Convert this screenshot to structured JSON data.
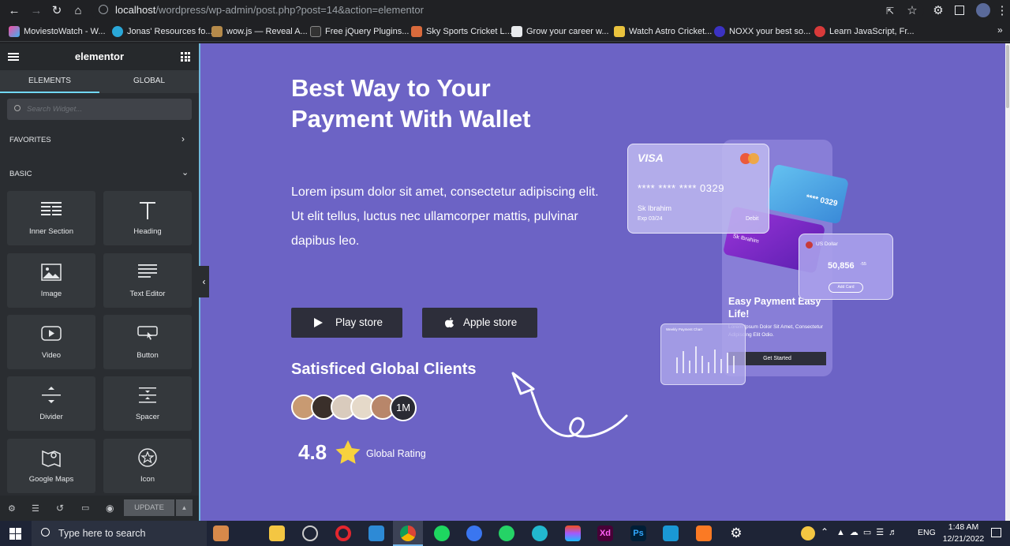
{
  "browser": {
    "url_host": "localhost",
    "url_path": "/wordpress/wp-admin/post.php?post=14&action=elementor",
    "bookmarks": [
      "MoviestoWatch - W...",
      "Jonas' Resources fo...",
      "wow.js — Reveal A...",
      "Free jQuery Plugins...",
      "Sky Sports Cricket L...",
      "Grow your career w...",
      "Watch Astro Cricket...",
      "NOXX your best so...",
      "Learn JavaScript, Fr..."
    ]
  },
  "editor": {
    "logo": "elementor",
    "tabs": [
      "ELEMENTS",
      "GLOBAL"
    ],
    "search_placeholder": "Search Widget...",
    "favorites_label": "FAVORITES",
    "basic_label": "BASIC",
    "widgets": [
      "Inner Section",
      "Heading",
      "Image",
      "Text Editor",
      "Video",
      "Button",
      "Divider",
      "Spacer",
      "Google Maps",
      "Icon"
    ],
    "update_label": "UPDATE"
  },
  "hero": {
    "title": "Best Way to Your Payment With Wallet",
    "paragraph": "Lorem ipsum dolor sit amet, consectetur adipiscing elit. Ut elit tellus, luctus nec ullamcorper mattis, pulvinar dapibus leo.",
    "play_store": "Play store",
    "apple_store": "Apple store",
    "clients_heading": "Satisficed Global Clients",
    "clients_count": "1M",
    "rating": "4.8",
    "rating_label": "Global Rating"
  },
  "mockup": {
    "card_brand": "VISA",
    "card_number": "**** **** **** 0329",
    "card_number_short": "**** 0329",
    "card_holder": "Sk Ibrahim",
    "card_exp": "Exp 03/24",
    "card_type": "Debit",
    "currency": "US Dollar",
    "balance": "50,856",
    "balance_small": "-55",
    "add_card": "Add Card",
    "promo_title": "Easy Payment Easy Life!",
    "promo_text": "Lorem Ipsum Dolor Sit Amet, Consectetur Adipiscing Elit Odio.",
    "cta": "Get Started",
    "chart_title": "Weekly Payment Chart"
  },
  "taskbar": {
    "search_placeholder": "Type here to search",
    "lang": "ENG",
    "time": "1:48 AM",
    "date": "12/21/2022"
  }
}
